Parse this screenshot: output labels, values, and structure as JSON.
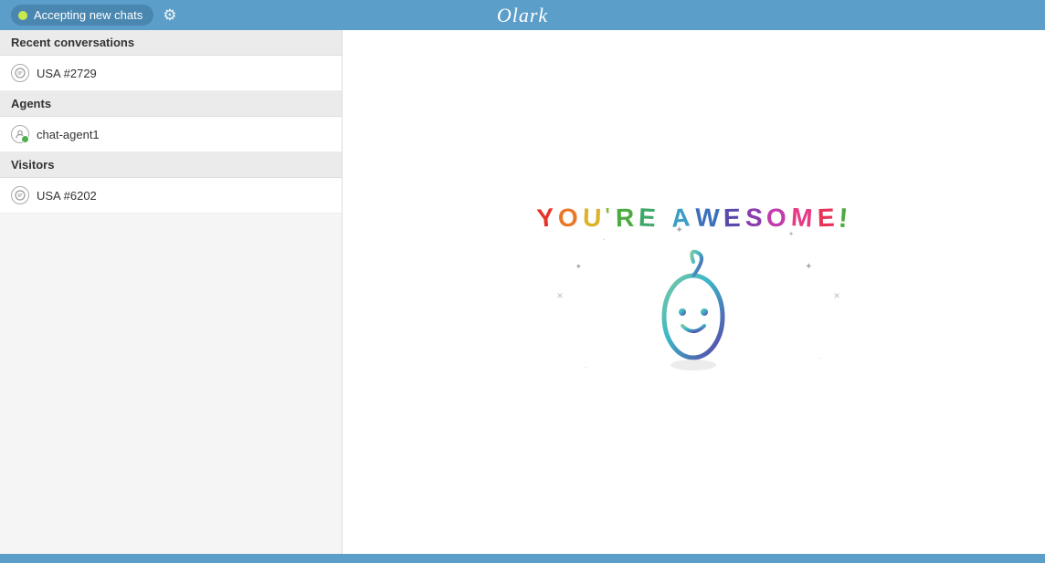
{
  "header": {
    "status_label": "Accepting new chats",
    "status_dot_color": "#c8e84e",
    "logo": "Olark",
    "gear_icon": "⚙"
  },
  "sidebar": {
    "sections": [
      {
        "id": "recent-conversations",
        "label": "Recent conversations",
        "items": [
          {
            "id": "convo-2729",
            "label": "USA #2729"
          }
        ]
      },
      {
        "id": "agents",
        "label": "Agents",
        "items": [
          {
            "id": "agent-1",
            "label": "chat-agent1"
          }
        ]
      },
      {
        "id": "visitors",
        "label": "Visitors",
        "items": [
          {
            "id": "visitor-6202",
            "label": "USA #6202"
          }
        ]
      }
    ]
  },
  "content": {
    "awesome_text": "YOU'RE AWESOME!",
    "awesome_letters": [
      {
        "char": "Y",
        "color": "#e63329"
      },
      {
        "char": "O",
        "color": "#e8792a"
      },
      {
        "char": "U",
        "color": "#dbb22a"
      },
      {
        "char": "'",
        "color": "#8aba3a"
      },
      {
        "char": "R",
        "color": "#4cab3f"
      },
      {
        "char": "E",
        "color": "#3ca868"
      },
      {
        "char": " ",
        "color": "#ccc"
      },
      {
        "char": "A",
        "color": "#3c9ec5"
      },
      {
        "char": "W",
        "color": "#3b6fba"
      },
      {
        "char": "E",
        "color": "#5a4aab"
      },
      {
        "char": "S",
        "color": "#8a3dab"
      },
      {
        "char": "O",
        "color": "#c23bab"
      },
      {
        "char": "M",
        "color": "#e63a85"
      },
      {
        "char": "E",
        "color": "#e63358"
      },
      {
        "char": "!",
        "color": "#4cab3f"
      }
    ]
  }
}
